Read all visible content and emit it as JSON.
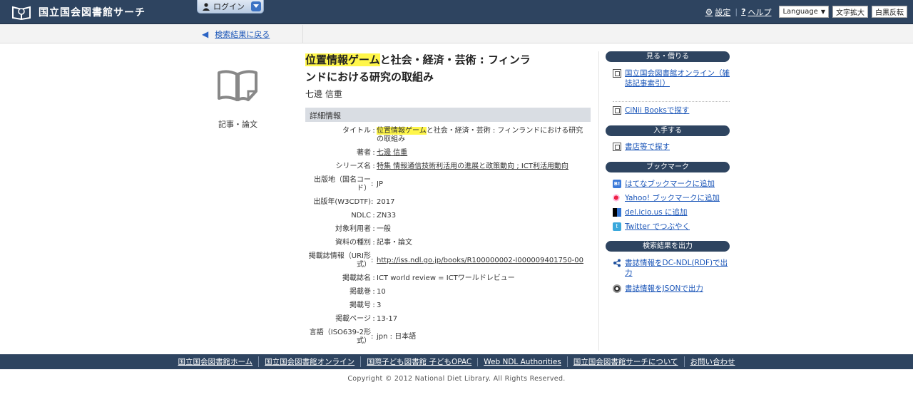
{
  "header": {
    "site_title": "国立国会図書館サーチ",
    "login_label": "ログイン",
    "settings_label": "設定",
    "help_label": "ヘルプ",
    "language_label": "Language",
    "font_enlarge_label": "文字拡大",
    "contrast_label": "白黒反転"
  },
  "breadcrumb": {
    "back_label": "検索結果に戻る"
  },
  "record": {
    "type_label": "記事・論文",
    "title_highlight": "位置情報ゲーム",
    "title_rest": "と社会・経済・芸術 : フィンランドにおける研究の取組み",
    "author": "七邊 信重"
  },
  "details": {
    "section_title": "詳細情報",
    "rows": [
      {
        "label": "タイトル",
        "highlight": "位置情報ゲーム",
        "value": "と社会・経済・芸術 : フィンランドにおける研究の取組み"
      },
      {
        "label": "著者",
        "value": "七邊 信重",
        "link": true
      },
      {
        "label": "シリーズ名",
        "value": "特集 情報通信技術利活用の進展と政策動向 ; ICT利活用動向",
        "link": true
      },
      {
        "label": "出版地（国名コード）",
        "value": "JP"
      },
      {
        "label": "出版年(W3CDTF)",
        "value": "2017"
      },
      {
        "label": "NDLC",
        "value": "ZN33"
      },
      {
        "label": "対象利用者",
        "value": "一般"
      },
      {
        "label": "資料の種別",
        "value": "記事・論文"
      },
      {
        "label": "掲載誌情報（URI形式）",
        "value": "http://iss.ndl.go.jp/books/R100000002-I000009401750-00",
        "link": true
      },
      {
        "label": "掲載誌名",
        "value": "ICT world review = ICTワールドレビュー"
      },
      {
        "label": "掲載巻",
        "value": "10"
      },
      {
        "label": "掲載号",
        "value": "3"
      },
      {
        "label": "掲載ページ",
        "value": "13-17"
      },
      {
        "label": "言語（ISO639-2形式）",
        "value": "jpn : 日本語"
      }
    ]
  },
  "sidebar": {
    "view_borrow": {
      "title": "見る・借りる",
      "items": [
        "国立国会図書館オンライン（雑誌記事索引）",
        "CiNii Booksで探す"
      ]
    },
    "obtain": {
      "title": "入手する",
      "items": [
        "書店等で探す"
      ]
    },
    "bookmark": {
      "title": "ブックマーク",
      "items": [
        "はてなブックマークに追加",
        "Yahoo! ブックマークに追加",
        "del.icio.us に追加",
        "Twitter でつぶやく"
      ]
    },
    "export": {
      "title": "検索結果を出力",
      "items": [
        "書誌情報をDC-NDL(RDF)で出力",
        "書誌情報をJSONで出力"
      ]
    }
  },
  "footer": {
    "links": [
      "国立国会図書館ホーム",
      "国立国会図書館オンライン",
      "国際子ども図書館 子どもOPAC",
      "Web NDL Authorities",
      "国立国会図書館サーチについて",
      "お問い合わせ"
    ],
    "copyright": "Copyright © 2012 National Diet Library. All Rights Reserved."
  },
  "colors": {
    "header_bg": "#2e4460",
    "highlight": "#fff64a",
    "link": "#1a55b8"
  }
}
